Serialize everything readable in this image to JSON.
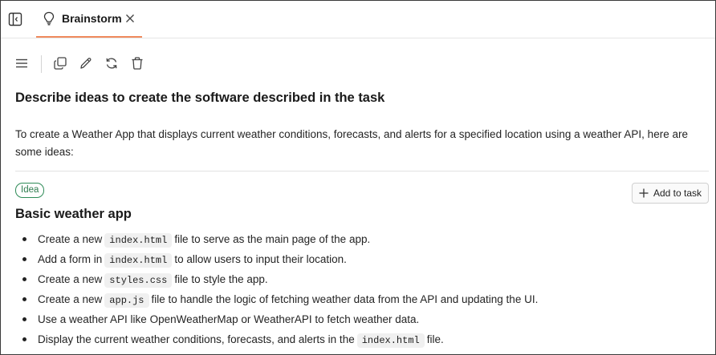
{
  "tab": {
    "label": "Brainstorm",
    "icon": "lightbulb-icon",
    "accent_color": "#f08a5d"
  },
  "toolbar": {
    "icons": [
      "menu-icon",
      "copy-icon",
      "edit-icon",
      "refresh-icon",
      "trash-icon"
    ]
  },
  "content": {
    "heading": "Describe ideas to create the software described in the task",
    "intro": "To create a Weather App that displays current weather conditions, forecasts, and alerts for a specified location using a weather API, here are some ideas:"
  },
  "idea": {
    "badge": "Idea",
    "badge_color": "#2e8b57",
    "add_button": "Add to task",
    "title": "Basic weather app",
    "items": [
      {
        "before": "Create a new",
        "code": "index.html",
        "after": "file to serve as the main page of the app."
      },
      {
        "before": "Add a form in",
        "code": "index.html",
        "after": "to allow users to input their location."
      },
      {
        "before": "Create a new",
        "code": "styles.css",
        "after": "file to style the app."
      },
      {
        "before": "Create a new",
        "code": "app.js",
        "after": "file to handle the logic of fetching weather data from the API and updating the UI."
      },
      {
        "before": "Use a weather API like OpenWeatherMap or WeatherAPI to fetch weather data.",
        "code": "",
        "after": ""
      },
      {
        "before": "Display the current weather conditions, forecasts, and alerts in the",
        "code": "index.html",
        "after": "file."
      }
    ]
  }
}
